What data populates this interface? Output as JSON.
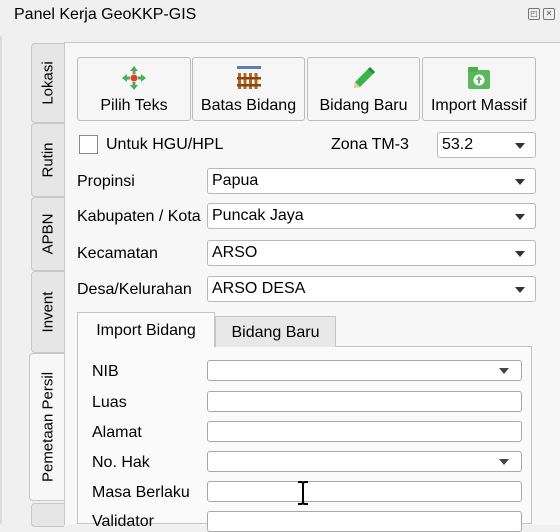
{
  "window": {
    "title": "Panel Kerja GeoKKP-GIS"
  },
  "side_tabs": [
    {
      "label": "Lokasi"
    },
    {
      "label": "Rutin"
    },
    {
      "label": "APBN"
    },
    {
      "label": "Invent"
    },
    {
      "label": "Pemetaan Persil"
    }
  ],
  "toolbar": {
    "pilih_teks": "Pilih Teks",
    "batas_bidang": "Batas Bidang",
    "bidang_baru": "Bidang Baru",
    "import_massif": "Import Massif"
  },
  "form": {
    "hgu_label": "Untuk HGU/HPL",
    "zona_label": "Zona TM-3",
    "zona_value": "53.2",
    "propinsi_label": "Propinsi",
    "propinsi_value": "Papua",
    "kabupaten_label": "Kabupaten / Kota",
    "kabupaten_value": "Puncak Jaya",
    "kecamatan_label": "Kecamatan",
    "kecamatan_value": "ARSO",
    "desa_label": "Desa/Kelurahan",
    "desa_value": "ARSO DESA"
  },
  "inner_tabs": {
    "import_bidang": "Import Bidang",
    "bidang_baru": "Bidang Baru"
  },
  "import_form": {
    "nib": "NIB",
    "luas": "Luas",
    "alamat": "Alamat",
    "no_hak": "No. Hak",
    "masa_berlaku": "Masa Berlaku",
    "validator": "Validator"
  },
  "icons": [
    "target-icon",
    "fence-icon",
    "pencil-icon",
    "import-icon",
    "float-icon",
    "close-icon"
  ]
}
